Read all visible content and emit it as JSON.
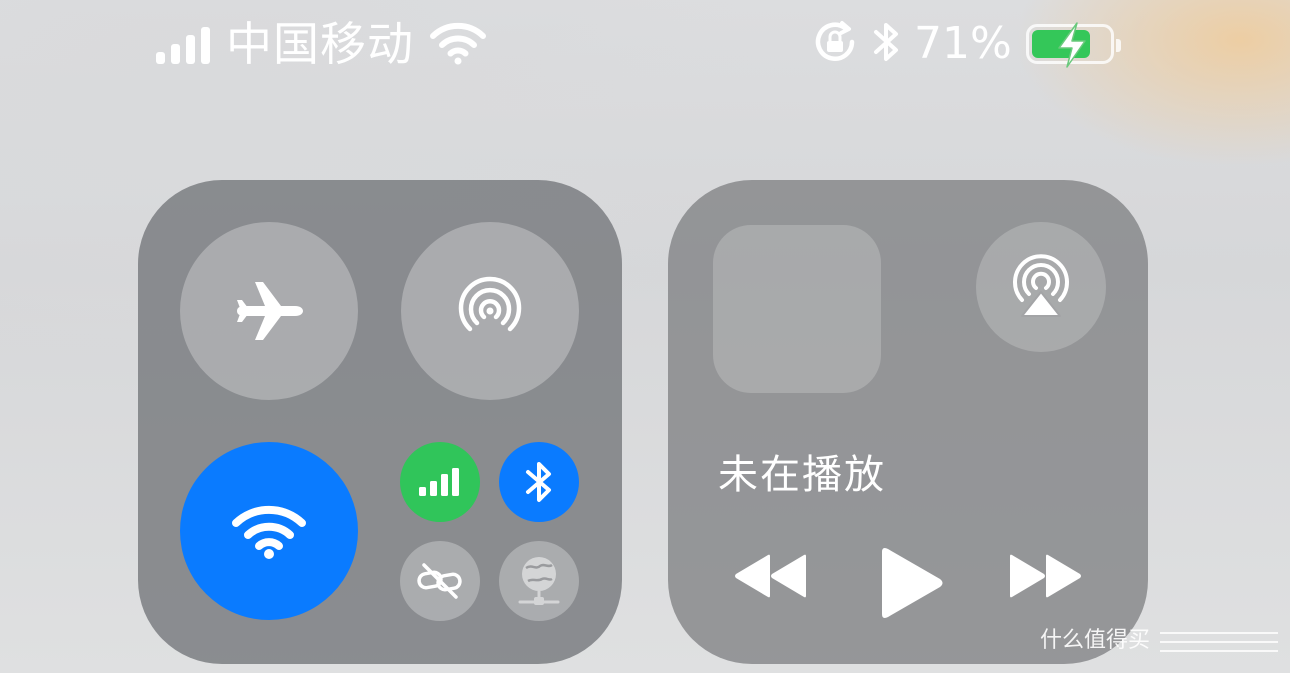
{
  "status_bar": {
    "carrier": "中国移动",
    "battery_percent": "71%",
    "battery_level": 0.71,
    "icons": [
      "signal-bars-icon",
      "wifi-icon",
      "orientation-lock-icon",
      "bluetooth-icon",
      "battery-charging-icon"
    ]
  },
  "connectivity": {
    "airplane_mode": {
      "icon": "airplane-icon",
      "on": false
    },
    "airdrop": {
      "icon": "airdrop-icon",
      "on": false
    },
    "wifi": {
      "icon": "wifi-icon",
      "on": true
    },
    "cellular_data": {
      "icon": "cellular-bars-icon",
      "on": true
    },
    "bluetooth": {
      "icon": "bluetooth-icon",
      "on": true
    },
    "personal_hotspot": {
      "icon": "hotspot-link-icon",
      "on": false
    },
    "vpn": {
      "icon": "vpn-globe-icon",
      "on": false
    }
  },
  "now_playing": {
    "title": "未在播放",
    "airplay_icon": "airplay-audio-icon",
    "controls": [
      "rewind-icon",
      "play-icon",
      "fast-forward-icon"
    ]
  },
  "colors": {
    "accent_blue": "#0a7bff",
    "cellular_green": "#30c55a",
    "battery_green": "#34c759"
  },
  "watermark": "什么值得买"
}
